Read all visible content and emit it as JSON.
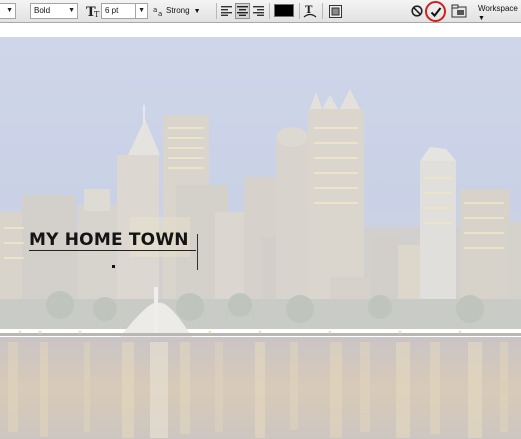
{
  "toolbar": {
    "font_style": "Bold",
    "size_icon": "font-size-icon",
    "font_size": "6 pt",
    "aa_icon": "anti-alias-icon",
    "aa_glyph": "a",
    "aa_method": "Strong",
    "align": [
      "left",
      "center",
      "right"
    ],
    "active_align": "center",
    "text_color": "#000000",
    "workspace_label": "Workspace"
  },
  "canvas": {
    "headline": "MY HOME TOWN"
  },
  "colors": {
    "highlight_ring": "#d21e1e",
    "sky": "#c7d0e6",
    "water": "#d9c9b5"
  }
}
